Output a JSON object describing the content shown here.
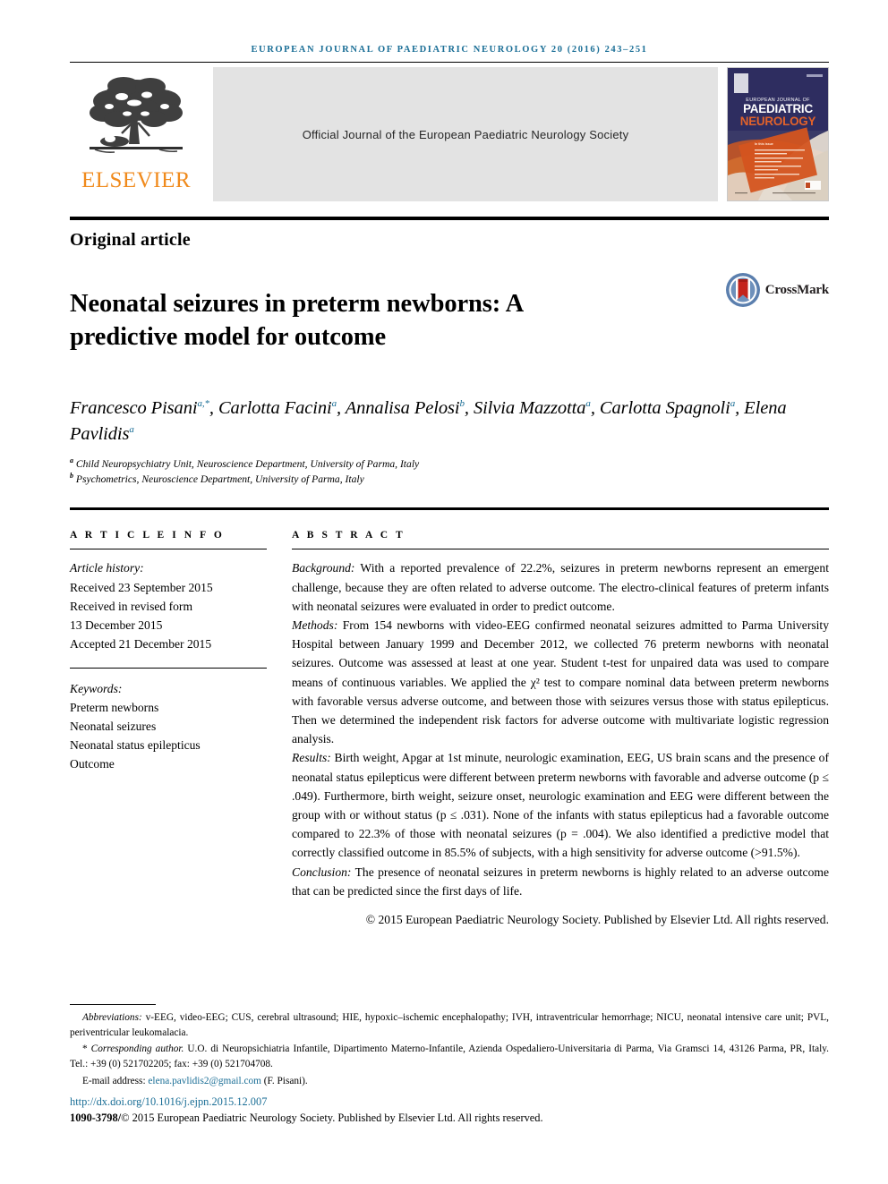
{
  "running_head": "EUROPEAN JOURNAL OF PAEDIATRIC NEUROLOGY 20 (2016) 243–251",
  "masthead": {
    "publisher_name": "ELSEVIER",
    "band_text": "Official Journal of the European Paediatric Neurology Society",
    "cover": {
      "kicker": "EUROPEAN JOURNAL OF",
      "line1": "PAEDIATRIC",
      "line2": "NEUROLOGY",
      "inside_label": "In this issue"
    }
  },
  "article_type": "Original article",
  "title": "Neonatal seizures in preterm newborns: A predictive model for outcome",
  "crossmark": {
    "label": "CrossMark"
  },
  "authors": {
    "line1_a": "Francesco Pisani",
    "line1_a_sup": "a,*",
    "line1_b": "Carlotta Facini",
    "line1_b_sup": "a",
    "line1_c": "Annalisa Pelosi",
    "line1_c_sup": "b",
    "line1_d": "Silvia Mazzotta",
    "line1_d_sup": "a",
    "line2_a": "Carlotta Spagnoli",
    "line2_a_sup": "a",
    "line2_b": "Elena Pavlidis",
    "line2_b_sup": "a"
  },
  "affiliations": [
    {
      "marker": "a",
      "text": "Child Neuropsychiatry Unit, Neuroscience Department, University of Parma, Italy"
    },
    {
      "marker": "b",
      "text": "Psychometrics, Neuroscience Department, University of Parma, Italy"
    }
  ],
  "article_info": {
    "heading": "A R T I C L E   I N F O",
    "history_label": "Article history:",
    "history": [
      "Received 23 September 2015",
      "Received in revised form",
      "13 December 2015",
      "Accepted 21 December 2015"
    ],
    "keywords_label": "Keywords:",
    "keywords": [
      "Preterm newborns",
      "Neonatal seizures",
      "Neonatal status epilepticus",
      "Outcome"
    ]
  },
  "abstract": {
    "heading": "A B S T R A C T",
    "background_label": "Background:",
    "background_text": " With a reported prevalence of 22.2%, seizures in preterm newborns represent an emergent challenge, because they are often related to adverse outcome. The electro-clinical features of preterm infants with neonatal seizures were evaluated in order to predict outcome.",
    "methods_label": "Methods:",
    "methods_text": " From 154 newborns with video-EEG confirmed neonatal seizures admitted to Parma University Hospital between January 1999 and December 2012, we collected 76 preterm newborns with neonatal seizures. Outcome was assessed at least at one year. Student t-test for unpaired data was used to compare means of continuous variables. We applied the χ² test to compare nominal data between preterm newborns with favorable versus adverse outcome, and between those with seizures versus those with status epilepticus. Then we determined the independent risk factors for adverse outcome with multivariate logistic regression analysis.",
    "results_label": "Results:",
    "results_text": " Birth weight, Apgar at 1st minute, neurologic examination, EEG, US brain scans and the presence of neonatal status epilepticus were different between preterm newborns with favorable and adverse outcome (p ≤ .049). Furthermore, birth weight, seizure onset, neurologic examination and EEG were different between the group with or without status (p ≤ .031). None of the infants with status epilepticus had a favorable outcome compared to 22.3% of those with neonatal seizures (p = .004). We also identified a predictive model that correctly classified outcome in 85.5% of subjects, with a high sensitivity for adverse outcome (>91.5%).",
    "conclusion_label": "Conclusion:",
    "conclusion_text": " The presence of neonatal seizures in preterm newborns is highly related to an adverse outcome that can be predicted since the first days of life.",
    "copyright": "© 2015 European Paediatric Neurology Society. Published by Elsevier Ltd. All rights reserved."
  },
  "footnotes": {
    "abbreviations_label": "Abbreviations:",
    "abbreviations_text": " v-EEG, video-EEG; CUS, cerebral ultrasound; HIE, hypoxic–ischemic encephalopathy; IVH, intraventricular hemorrhage; NICU, neonatal intensive care unit; PVL, periventricular leukomalacia.",
    "corresponding_marker": "*",
    "corresponding_label": "Corresponding author.",
    "corresponding_text": " U.O. di Neuropsichiatria Infantile, Dipartimento Materno-Infantile, Azienda Ospedaliero-Universitaria di Parma, Via Gramsci 14, 43126 Parma, PR, Italy. Tel.: +39 (0) 521702205; fax: +39 (0) 521704708.",
    "email_label": "E-mail address:",
    "email": "elena.pavlidis2@gmail.com",
    "email_suffix": " (F. Pisani).",
    "doi": "http://dx.doi.org/10.1016/j.ejpn.2015.12.007",
    "issn_prefix": "1090-3798/",
    "issn_text": "© 2015 European Paediatric Neurology Society. Published by Elsevier Ltd. All rights reserved."
  },
  "colors": {
    "accent_blue": "#1a6e96",
    "elsevier_orange": "#f08a1c",
    "cover_navy": "#2e2d60",
    "cover_orange": "#d4541f",
    "band_gray": "#e3e3e3"
  }
}
